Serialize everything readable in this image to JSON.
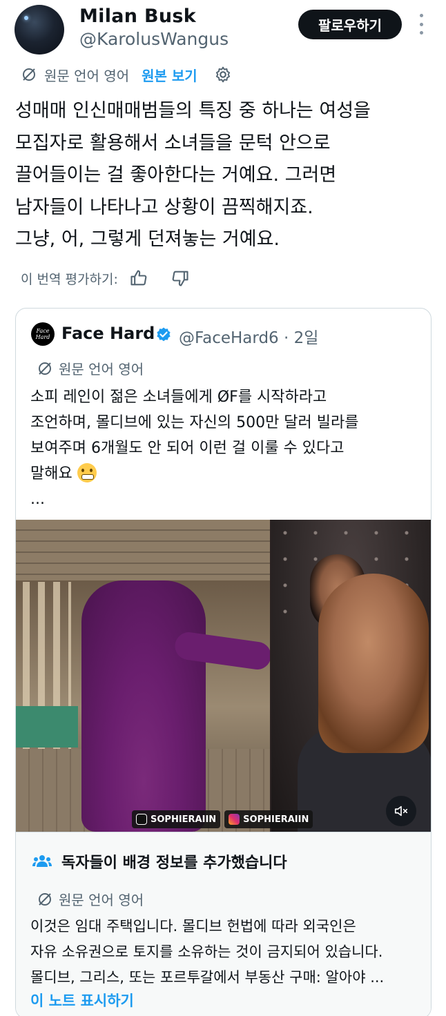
{
  "author": {
    "display_name": "Milan Busk",
    "handle": "@KarolusWangus",
    "follow_label": "팔로우하기"
  },
  "translation": {
    "original_language": "원문 언어 영어",
    "view_original": "원본 보기"
  },
  "tweet": {
    "lines": [
      "성매매 인신매매범들의 특징 중 하나는 여성을",
      "모집자로 활용해서 소녀들을 문턱 안으로",
      "끌어들이는 걸 좋아한다는 거예요. 그러면",
      "남자들이 나타나고 상황이 끔찍해지죠.",
      "그냥, 어, 그렇게 던져놓는 거예요."
    ],
    "rate_label": "이 번역 평가하기:"
  },
  "quoted": {
    "avatar_text": "Face Hard",
    "display_name": "Face Hard",
    "handle_time": "@FaceHard6 · 2일",
    "original_language": "원문 언어 영어",
    "lines": [
      "소피 레인이 젊은 소녀들에게 ØF를 시작하라고",
      "조언하며, 몰디브에 있는 자신의 500만 달러 빌라를",
      "보여주며 6개월도 안 되어 이런 걸 이룰 수 있다고",
      "말해요"
    ],
    "ellipsis": "...",
    "media": {
      "watermark_tiktok": "SOPHIERAIIN",
      "watermark_instagram": "SOPHIERAIIN"
    }
  },
  "note": {
    "title": "독자들이 배경 정보를 추가했습니다",
    "original_language": "원문 언어 영어",
    "lines": [
      "이것은 임대 주택입니다. 몰디브 헌법에 따라 외국인은",
      "자유 소유권으로 토지를 소유하는 것이 금지되어 있습니다.",
      "몰디브, 그리스, 또는 포르투갈에서 부동산 구매: 알아야 ..."
    ],
    "show_link": "이 노트 표시하기"
  },
  "colors": {
    "accent": "#1d9bf0",
    "secondary_text": "#536471",
    "border": "#cfd9de"
  }
}
